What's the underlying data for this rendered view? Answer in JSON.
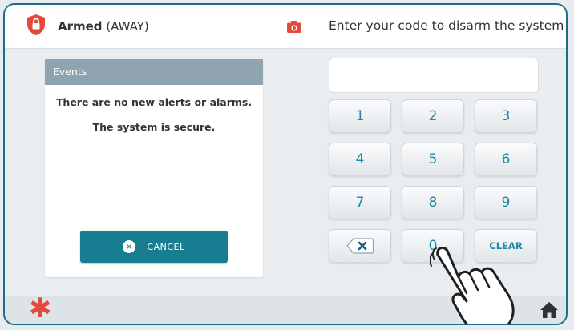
{
  "header": {
    "status_bold": "Armed",
    "status_mode": "(AWAY)",
    "prompt": "Enter your code to disarm the system",
    "icons": {
      "lock_shield": "shield-lock-icon",
      "camera": "camera-icon"
    },
    "colors": {
      "shield": "#e24b3b",
      "camera": "#e24b3b"
    }
  },
  "events": {
    "title": "Events",
    "line1": "There are no new alerts or alarms.",
    "line2": "The system is secure.",
    "cancel_label": "CANCEL"
  },
  "keypad": {
    "code_value": "",
    "keys": [
      "1",
      "2",
      "3",
      "4",
      "5",
      "6",
      "7",
      "8",
      "9",
      "0"
    ],
    "clear_label": "CLEAR"
  },
  "footer": {
    "emergency_icon": "asterisk-icon",
    "home_icon": "home-icon"
  },
  "colors": {
    "accent": "#177e92",
    "key_text": "#1b8aa6",
    "header_panel": "#8fa3b0",
    "alert": "#e24b3b"
  }
}
